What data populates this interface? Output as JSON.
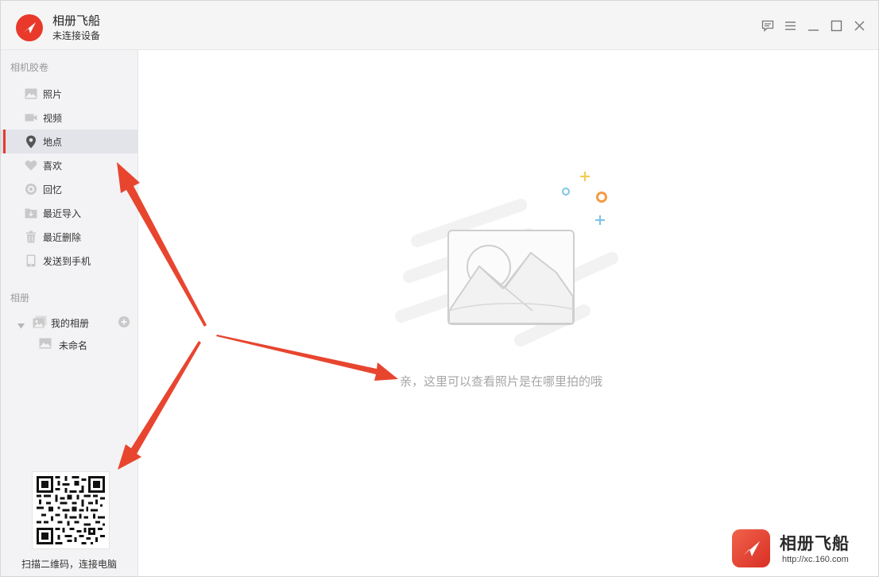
{
  "app": {
    "name": "相册飞船",
    "status": "未连接设备"
  },
  "window_controls": [
    "feedback-icon",
    "menu-icon",
    "minimize-icon",
    "maximize-icon",
    "close-icon"
  ],
  "sidebar": {
    "camera_roll_title": "相机胶卷",
    "items": [
      {
        "label": "照片",
        "icon": "photo-icon"
      },
      {
        "label": "视频",
        "icon": "video-icon"
      },
      {
        "label": "地点",
        "icon": "location-icon",
        "active": true
      },
      {
        "label": "喜欢",
        "icon": "heart-icon"
      },
      {
        "label": "回忆",
        "icon": "memory-icon"
      },
      {
        "label": "最近导入",
        "icon": "import-icon"
      },
      {
        "label": "最近删除",
        "icon": "trash-icon"
      },
      {
        "label": "发送到手机",
        "icon": "phone-icon"
      }
    ],
    "albums_title": "相册",
    "my_albums": "我的相册",
    "album_children": [
      "未命名"
    ],
    "qr_caption": "扫描二维码，连接电脑"
  },
  "main": {
    "empty_hint": "亲，这里可以查看照片是在哪里拍的哦"
  },
  "brand": {
    "name": "相册飞船",
    "url": "http://xc.160.com"
  },
  "colors": {
    "accent": "#e8392b",
    "arrow": "#e8452f",
    "active_bg": "#e2e4ea",
    "sidebar_bg": "#f3f3f5"
  }
}
